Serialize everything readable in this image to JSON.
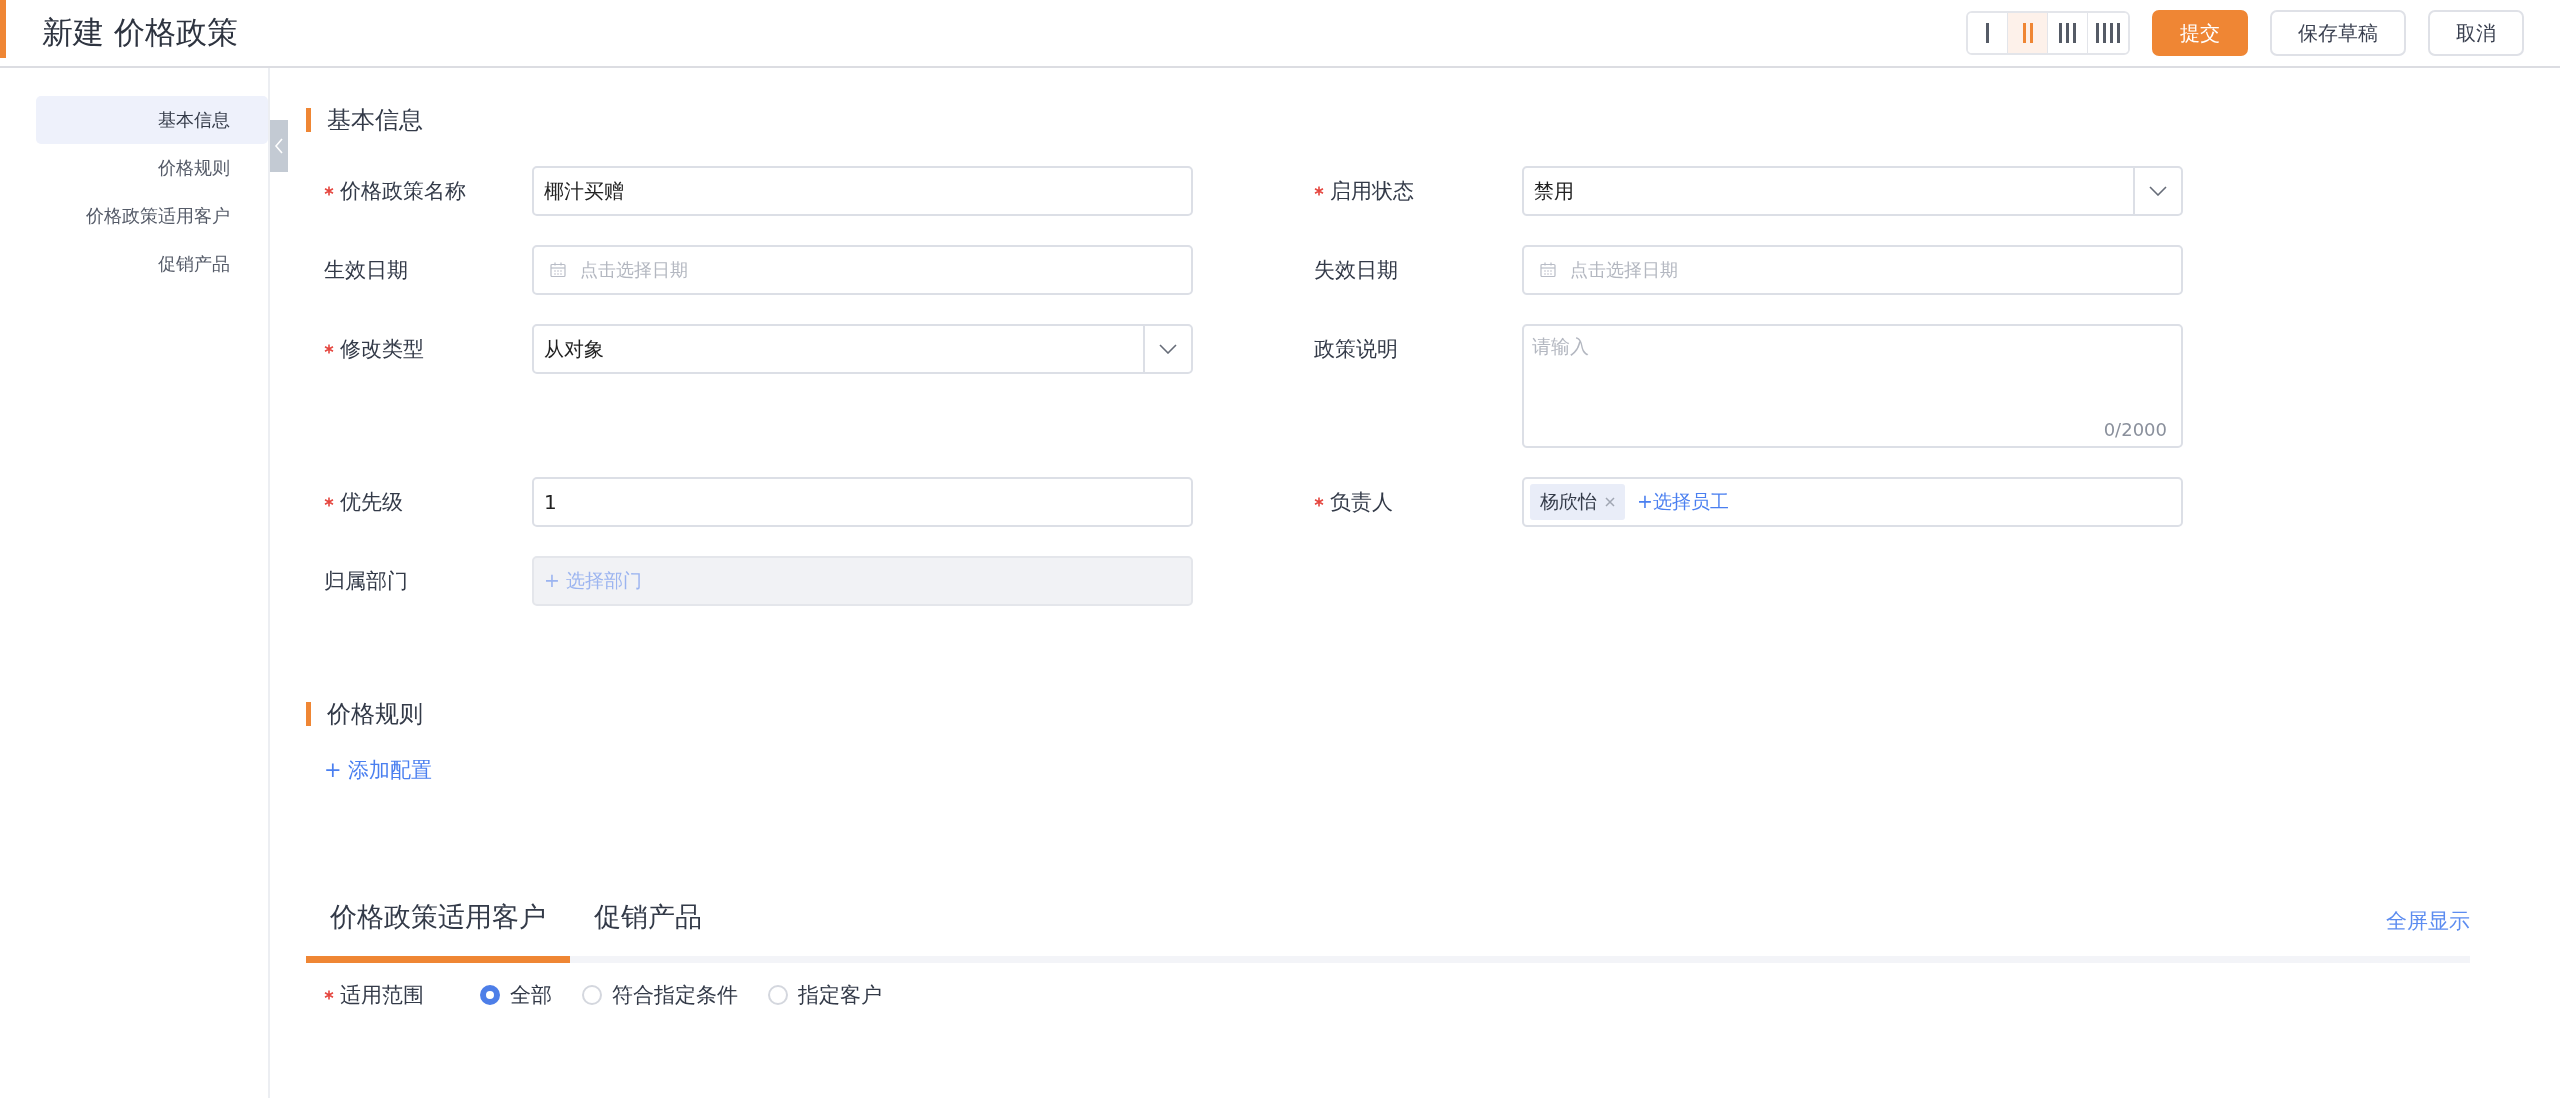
{
  "header": {
    "title": "新建 价格政策",
    "layout_options": [
      {
        "kind": "one",
        "selected": false
      },
      {
        "kind": "two",
        "selected": true
      },
      {
        "kind": "three",
        "selected": false
      },
      {
        "kind": "four",
        "selected": false
      }
    ],
    "buttons": [
      {
        "label": "提交",
        "kind": "primary"
      },
      {
        "label": "保存草稿",
        "kind": "default"
      },
      {
        "label": "取消",
        "kind": "default"
      }
    ]
  },
  "sidebar": {
    "items": [
      {
        "label": "基本信息",
        "selected": true
      },
      {
        "label": "价格规则",
        "selected": false
      },
      {
        "label": "价格政策适用客户",
        "selected": false
      },
      {
        "label": "促销产品",
        "selected": false
      }
    ]
  },
  "basic_info": {
    "title": "基本信息",
    "fields": [
      {
        "label": "价格政策名称",
        "required": true,
        "kind": "text",
        "value": "椰汁买赠",
        "disabled": false
      },
      {
        "label": "启用状态",
        "required": true,
        "kind": "select",
        "value": "禁用",
        "disabled": false
      },
      {
        "label": "生效日期",
        "required": false,
        "kind": "date",
        "placeholder": "点击选择日期",
        "disabled": false
      },
      {
        "label": "失效日期",
        "required": false,
        "kind": "date",
        "placeholder": "点击选择日期",
        "disabled": false
      },
      {
        "label": "修改类型",
        "required": true,
        "kind": "select",
        "value": "从对象",
        "disabled": false
      },
      {
        "label": "政策说明",
        "required": false,
        "kind": "textarea",
        "placeholder": "请输入",
        "counter": "0/2000",
        "disabled": false
      },
      {
        "label": "优先级",
        "required": true,
        "kind": "text",
        "value": "1",
        "disabled": false
      },
      {
        "label": "负责人",
        "required": true,
        "kind": "tags",
        "tags": [
          {
            "label": "杨欣怡"
          }
        ],
        "add_label": "+选择员工",
        "disabled": false
      },
      {
        "label": "归属部门",
        "required": false,
        "kind": "picker",
        "add_label": "+ 选择部门",
        "disabled": true
      }
    ]
  },
  "price_rules": {
    "title": "价格规则",
    "add_link": "+ 添加配置"
  },
  "detail_tabs": {
    "tabs": [
      {
        "label": "价格政策适用客户",
        "selected": true
      },
      {
        "label": "促销产品",
        "selected": false
      }
    ],
    "fullscreen_link": "全屏显示"
  },
  "scope": {
    "label": "适用范围",
    "required": true,
    "options": [
      {
        "label": "全部",
        "selected": true
      },
      {
        "label": "符合指定条件",
        "selected": false
      },
      {
        "label": "指定客户",
        "selected": false
      }
    ]
  }
}
